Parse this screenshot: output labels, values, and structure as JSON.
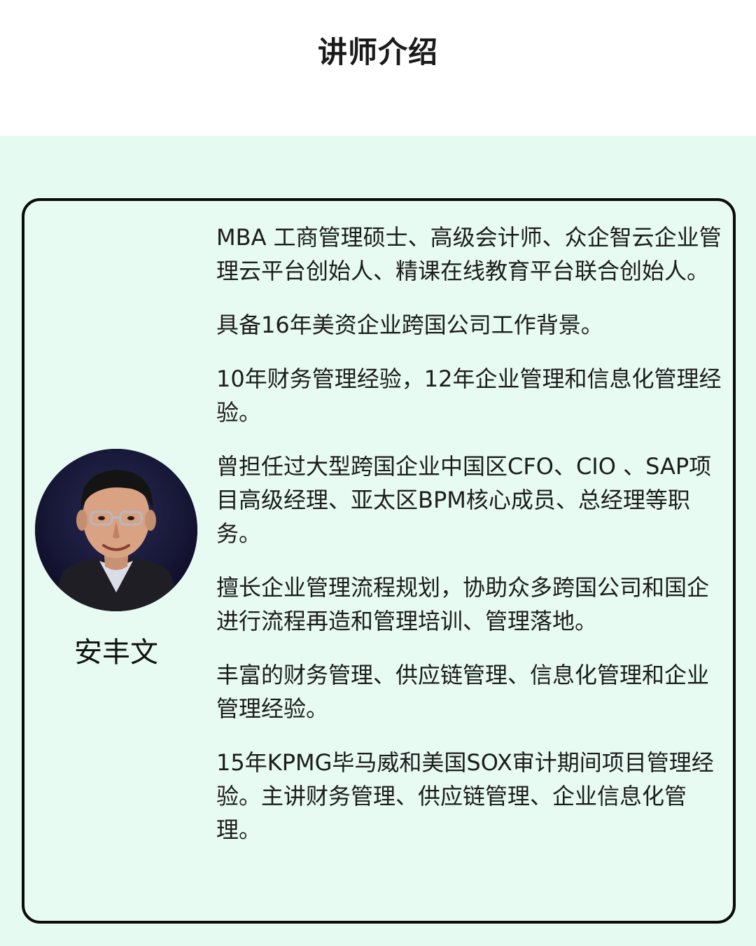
{
  "header": {
    "title": "讲师介绍"
  },
  "instructor": {
    "name": "安丰文",
    "avatar_icon": "portrait-photo",
    "bio": [
      "MBA 工商管理硕士、高级会计师、众企智云企业管理云平台创始人、精课在线教育平台联合创始人。",
      "具备16年美资企业跨国公司工作背景。",
      "10年财务管理经验，12年企业管理和信息化管理经验。",
      "曾担任过大型跨国企业中国区CFO、CIO 、SAP项目高级经理、亚太区BPM核心成员、总经理等职务。",
      "擅长企业管理流程规划，协助众多跨国公司和国企进行流程再造和管理培训、管理落地。",
      "丰富的财务管理、供应链管理、信息化管理和企业管理经验。",
      "15年KPMG毕马威和美国SOX审计期间项目管理经验。主讲财务管理、供应链管理、企业信息化管理。"
    ]
  },
  "colors": {
    "background_mint": "#e5fbf2",
    "card_border": "#0b0b0b",
    "text": "#1c1c1c"
  }
}
